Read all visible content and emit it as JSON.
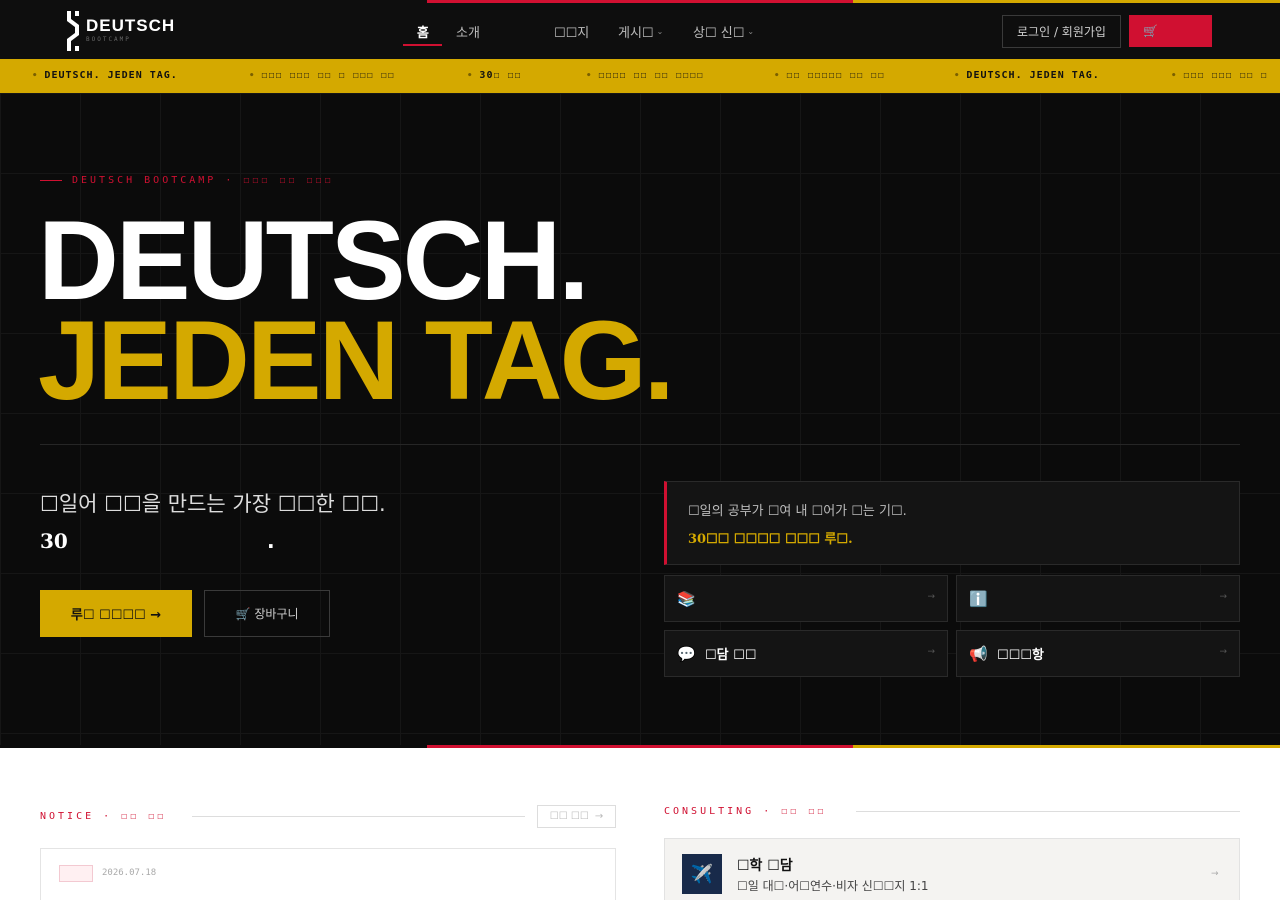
{
  "header": {
    "logo_name": "DEUTSCH",
    "logo_sub": "BOOTCAMP",
    "nav": [
      {
        "label": "홈",
        "has_dropdown": false,
        "active": true
      },
      {
        "label": "소개",
        "has_dropdown": false,
        "active": false
      },
      {
        "label": "☐☐지",
        "has_dropdown": false,
        "active": false
      },
      {
        "label": "게시☐",
        "has_dropdown": true,
        "active": false
      },
      {
        "label": "상☐ 신☐",
        "has_dropdown": true,
        "active": false
      }
    ],
    "login_label": "로그인 / 회원가입",
    "cart_icon": "🛒"
  },
  "ticker": [
    "DEUTSCH. JEDEN TAG.",
    "☐☐☐ ☐☐☐ ☐☐ ☐ ☐☐☐ ☐☐",
    "30☐ ☐☐",
    "☐☐☐☐ ☐☐ ☐☐ ☐☐☐☐",
    "☐☐ ☐☐☐☐☐ ☐☐ ☐☐",
    "DEUTSCH. JEDEN TAG.",
    "☐☐☐ ☐☐☐ ☐☐ ☐"
  ],
  "hero": {
    "eyebrow": "DEUTSCH BOOTCAMP · ☐☐☐ ☐☐ ☐☐☐",
    "headline_1": "DEUTSCH.",
    "headline_2": "JEDEN TAG.",
    "lead": "☐일어 ☐☐을 만드는 가장 ☐☐한 ☐☐.",
    "days": "30",
    "dot": ".",
    "primary_button": "루☐ ☐☐☐☐ →",
    "cart_button_icon": "🛒",
    "cart_button": "장바구니",
    "quote_line_1": "☐일의 공부가 ☐여 내 ☐어가 ☐는 기☐.",
    "quote_line_2": "30☐☐ ☐☐☐☐ ☐☐☐ 루☐.",
    "cards": [
      {
        "icon": "📚",
        "label": "",
        "arrow": "→"
      },
      {
        "icon": "ℹ️",
        "label": "",
        "arrow": "→"
      },
      {
        "icon": "💬",
        "label": "☐담 ☐☐",
        "arrow": "→"
      },
      {
        "icon": "📢",
        "label": "☐☐☐항",
        "arrow": "→"
      }
    ]
  },
  "notice": {
    "section_title": "NOTICE · ☐☐ ☐☐",
    "all_button": "☐☐ ☐☐",
    "all_arrow": "→",
    "items": [
      {
        "date": "2026.07.18"
      }
    ]
  },
  "consulting": {
    "section_title": "CONSULTING · ☐☐ ☐☐",
    "items": [
      {
        "icon": "✈️",
        "title": "☐학 ☐담",
        "desc": "☐일 대☐·어☐연수·비자 신☐☐지 1:1",
        "arrow": "→"
      }
    ]
  },
  "colors": {
    "accent_red": "#d01031",
    "accent_gold": "#d4a900",
    "background_dark": "#0b0b0b"
  }
}
